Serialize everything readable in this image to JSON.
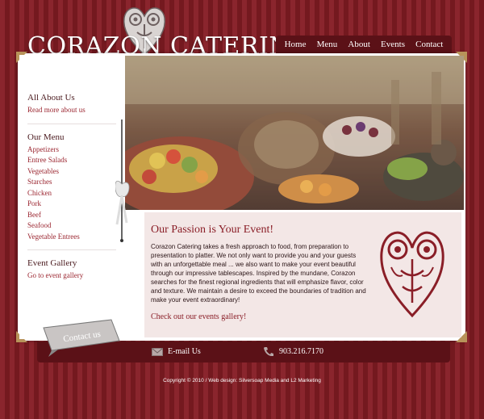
{
  "logo": "CORAZON CATERING",
  "nav": [
    "Home",
    "Menu",
    "About",
    "Events",
    "Contact"
  ],
  "sidebar": {
    "about": {
      "title": "All About Us",
      "link": "Read more about us"
    },
    "menu": {
      "title": "Our Menu",
      "items": [
        "Appetizers",
        "Entree Salads",
        "Vegetables",
        "Starches",
        "Chicken",
        "Pork",
        "Beef",
        "Seafood",
        "Vegetable Entrees"
      ]
    },
    "gallery": {
      "title": "Event Gallery",
      "link": "Go to event gallery"
    }
  },
  "main": {
    "heading": "Our Passion is Your Event!",
    "body": "Corazon Catering takes a fresh approach to food, from preparation to presentation to platter. We not only want to provide you and your guests with an unforgettable meal ... we also want to make your event beautiful through our impressive tablescapes. Inspired by the mundane, Corazon searches for the finest regional ingredients that will emphasize flavor, color and texture. We maintain a desire to exceed the boundaries of tradition and make your event extraordinary!",
    "gallery_link": "Check out our events gallery!"
  },
  "footer": {
    "contact_tab": "Contact us",
    "email_label": "E-mail Us",
    "phone": "903.216.7170",
    "copyright": "Copyright © 2010 / Web design: Silversoap Media and L2 Marketing"
  },
  "colors": {
    "brand": "#7d1f26",
    "accent": "#9b2630",
    "panel": "#f3e7e6",
    "nav": "#5b1117"
  }
}
